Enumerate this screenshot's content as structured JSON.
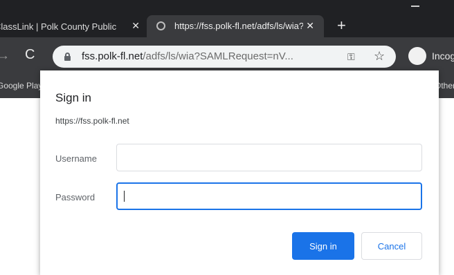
{
  "browser": {
    "tabs": [
      {
        "title": "ClassLink | Polk County Public Schools",
        "active": false
      },
      {
        "title": "https://fss.polk-fl.net/adfs/ls/wia?SAMLRequest=nV",
        "active": true
      }
    ],
    "new_tab_label": "+",
    "close_glyph": "✕",
    "nav": {
      "forward_glyph": "→",
      "reload_glyph": "C"
    },
    "address": {
      "host": "fss.polk-fl.net",
      "path": "/adfs/ls/wia?SAMLRequest=nV..."
    },
    "profile_label": "Incognito",
    "bookmarks": {
      "left": "Google Play",
      "right": "Other"
    }
  },
  "dialog": {
    "title": "Sign in",
    "origin": "https://fss.polk-fl.net",
    "username_label": "Username",
    "password_label": "Password",
    "username_value": "",
    "password_value": "",
    "signin_label": "Sign in",
    "cancel_label": "Cancel"
  },
  "colors": {
    "accent": "#1a73e8",
    "chrome_dark": "#202124",
    "toolbar": "#3a3b3e"
  },
  "icons": [
    "tab-favicon-icon",
    "close-icon",
    "new-tab-icon",
    "forward-icon",
    "reload-icon",
    "lock-icon",
    "key-icon",
    "star-icon",
    "incognito-icon"
  ]
}
